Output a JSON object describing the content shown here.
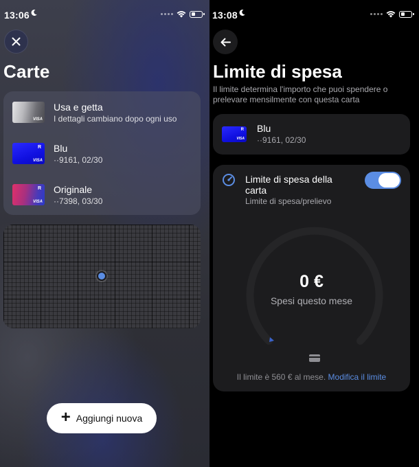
{
  "left": {
    "status": {
      "time": "13:06"
    },
    "title": "Carte",
    "cards": [
      {
        "name": "Usa e getta",
        "sub": "I dettagli cambiano dopo ogni uso",
        "brand": "VISA",
        "badge": "",
        "style": "disposable"
      },
      {
        "name": "Blu",
        "sub": "··9161, 02/30",
        "brand": "VISA",
        "badge": "R",
        "style": "blue"
      },
      {
        "name": "Originale",
        "sub": "··7398, 03/30",
        "brand": "VISA",
        "badge": "R",
        "style": "gradient"
      }
    ],
    "add_button": {
      "label": "Aggiungi nuova"
    }
  },
  "right": {
    "status": {
      "time": "13:08"
    },
    "title": "Limite di spesa",
    "description": "Il limite determina l'importo che puoi spendere o prelevare mensilmente con questa carta",
    "card": {
      "name": "Blu",
      "sub": "··9161, 02/30",
      "brand": "VISA",
      "badge": "R"
    },
    "limit": {
      "title": "Limite di spesa della carta",
      "subtitle": "Limite di spesa/prelievo",
      "toggle_on": true,
      "amount": "0 €",
      "amount_label": "Spesi questo mese",
      "spent_fraction": 0,
      "note": "Il limite è 560 € al mese.",
      "link": "Modifica il limite"
    }
  },
  "colors": {
    "accent": "#5b8de3",
    "panel_dark": "#1c1c1e",
    "card_blue": "#1a1aff"
  },
  "icons": [
    "moon-icon",
    "wifi-icon",
    "battery-icon",
    "close-icon",
    "back-arrow-icon",
    "plus-icon",
    "gauge-icon",
    "card-icon",
    "location-dot-icon"
  ]
}
